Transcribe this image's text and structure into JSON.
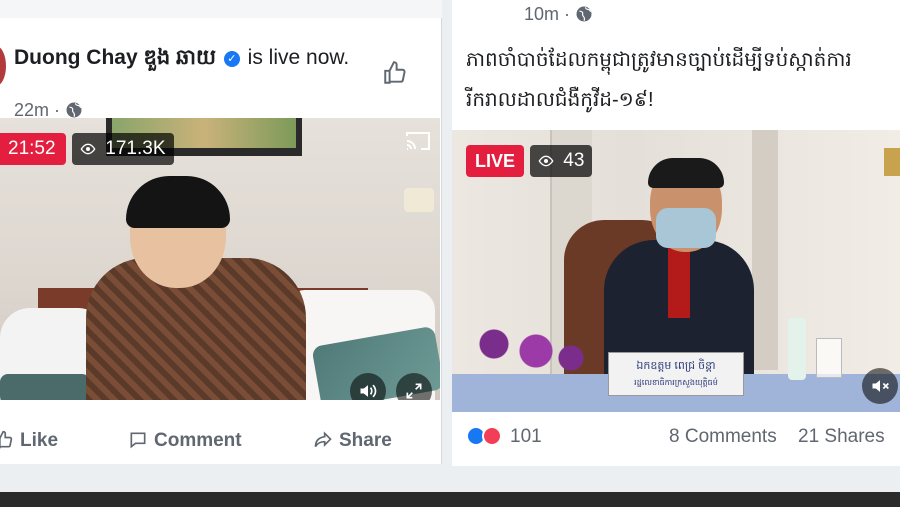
{
  "left_post": {
    "author": "Duong Chay ឌួង ឆាយ",
    "verified_mark": "✓",
    "status": "is live now.",
    "time": "22m",
    "sep": "·",
    "video": {
      "live_timer": "21:52",
      "viewers": "171.3K"
    },
    "actions": {
      "like": "Like",
      "comment": "Comment",
      "share": "Share"
    }
  },
  "right_post": {
    "time": "10m",
    "sep": "·",
    "text": "ភាពចាំបាច់ដែលកម្ពុជាត្រូវមានច្បាប់ដើម្បីទប់ស្កាត់ការរីករាលដាលជំងឺកូវីដ-១៩!",
    "video": {
      "live_label": "LIVE",
      "viewers": "43",
      "nameplate_name": "ឯកឧត្តម ពេជ្រ ចិន្តា",
      "nameplate_title": "រដ្ឋលេខាធិការក្រសួងយុត្តិធម៌"
    },
    "stats": {
      "reactions_count": "101",
      "comments": "8 Comments",
      "shares": "21 Shares"
    }
  },
  "colors": {
    "live_red": "#e41e3f",
    "facebook_blue": "#1877f2",
    "text_primary": "#1c1e21",
    "text_secondary": "#606770"
  }
}
